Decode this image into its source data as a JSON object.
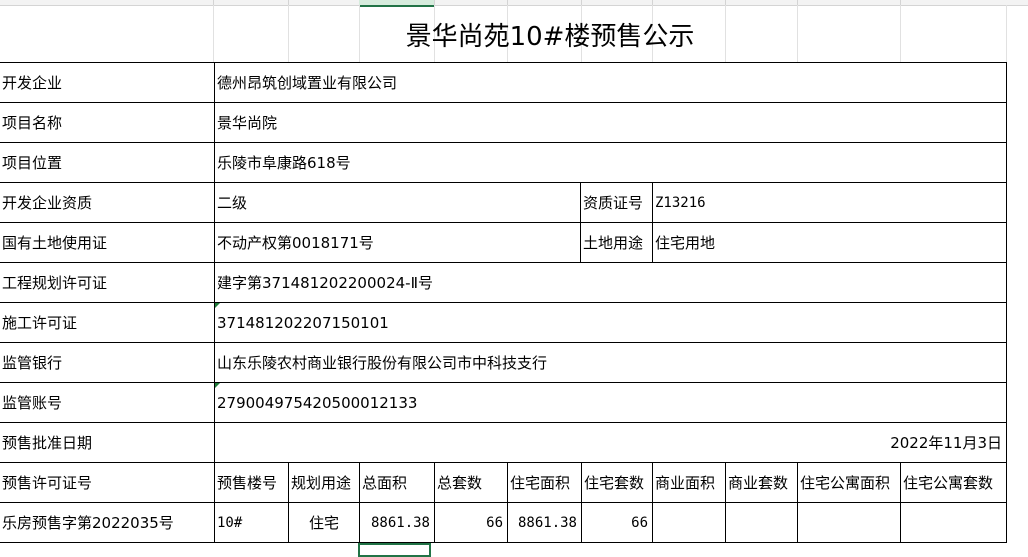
{
  "title": "景华尚苑10#楼预售公示",
  "rows": [
    {
      "label": "开发企业",
      "value": "德州昂筑创域置业有限公司"
    },
    {
      "label": "项目名称",
      "value": "景华尚院"
    },
    {
      "label": "项目位置",
      "value": "乐陵市阜康路618号"
    },
    {
      "label": "开发企业资质",
      "value": "二级",
      "label2": "资质证号",
      "value2": "Z13216"
    },
    {
      "label": "国有土地使用证",
      "value": "不动产权第0018171号",
      "label2": "土地用途",
      "value2": "住宅用地"
    },
    {
      "label": "工程规划许可证",
      "value": "建字第371481202200024-Ⅱ号"
    },
    {
      "label": "施工许可证",
      "value": "371481202207150101"
    },
    {
      "label": "监管银行",
      "value": "山东乐陵农村商业银行股份有限公司市中科技支行"
    },
    {
      "label": "监管账号",
      "value": "279004975420500012133"
    },
    {
      "label": "预售批准日期",
      "value": "2022年11月3日"
    }
  ],
  "table": {
    "headers": [
      "预售许可证号",
      "预售楼号",
      "规划用途",
      "总面积",
      "总套数",
      "住宅面积",
      "住宅套数",
      "商业面积",
      "商业套数",
      "住宅公寓面积",
      "住宅公寓套数"
    ],
    "rows": [
      [
        "乐房预售字第2022035号",
        "10#",
        "住宅",
        "8861.38",
        "66",
        "8861.38",
        "66",
        "",
        "",
        "",
        ""
      ]
    ]
  }
}
